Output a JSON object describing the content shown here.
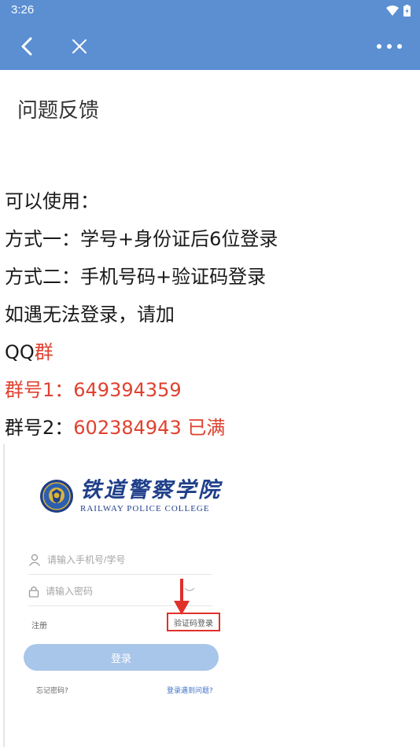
{
  "status_bar": {
    "time": "3:26"
  },
  "nav": {
    "back_icon": "chevron-left-icon",
    "close_icon": "close-icon",
    "more_icon": "more-dots-icon"
  },
  "page": {
    "title": "问题反馈"
  },
  "content": {
    "line1": "可以使用：",
    "line2": "方式一：学号+身份证后6位登录",
    "line3": "方式二：手机号码+验证码登录",
    "line4": "如遇无法登录，请加",
    "line5_prefix": "QQ",
    "line5_red": "群",
    "line6": "群号1：649394359",
    "line7_label": "群号2：",
    "line7_value": "602384943 已满"
  },
  "login_screenshot": {
    "logo_cn": "铁道警察学院",
    "logo_en": "RAILWAY POLICE COLLEGE",
    "phone_placeholder": "请输入手机号/学号",
    "password_placeholder": "请输入密码",
    "register_label": "注册",
    "code_login_label": "验证码登录",
    "login_button": "登录",
    "forgot_password": "忘记密码?",
    "login_problem": "登录遇到问题?"
  },
  "colors": {
    "header_blue": "#5b8fd2",
    "highlight_red": "#e0412f",
    "login_button": "#a8c5ea",
    "link_blue": "#3f73c9"
  }
}
